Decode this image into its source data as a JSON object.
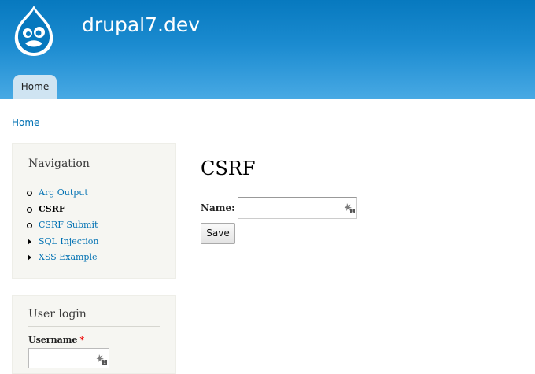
{
  "header": {
    "site_name": "drupal7.dev",
    "logo_icon": "drupal-drop-logo-icon",
    "tabs": [
      {
        "label": "Home",
        "active": true
      }
    ]
  },
  "breadcrumb": {
    "items": [
      "Home"
    ]
  },
  "sidebar": {
    "navigation": {
      "title": "Navigation",
      "items": [
        {
          "label": "Arg Output",
          "marker": "circle-bullet",
          "active": false
        },
        {
          "label": "CSRF",
          "marker": "circle-bullet",
          "active": true
        },
        {
          "label": "CSRF Submit",
          "marker": "circle-bullet",
          "active": false
        },
        {
          "label": "SQL Injection",
          "marker": "triangle-collapsed",
          "active": false
        },
        {
          "label": "XSS Example",
          "marker": "triangle-collapsed",
          "active": false
        }
      ]
    },
    "user_login": {
      "title": "User login",
      "username_label": "Username",
      "required_marker": "*",
      "username_value": ""
    }
  },
  "main": {
    "title": "CSRF",
    "form": {
      "name_label": "Name:",
      "name_value": "",
      "save_label": "Save"
    }
  },
  "colors": {
    "header_top": "#0779bf",
    "header_bottom": "#48a9e4",
    "link": "#0071b3",
    "sidebar_bg": "#f6f6f2",
    "required": "#e00000"
  }
}
